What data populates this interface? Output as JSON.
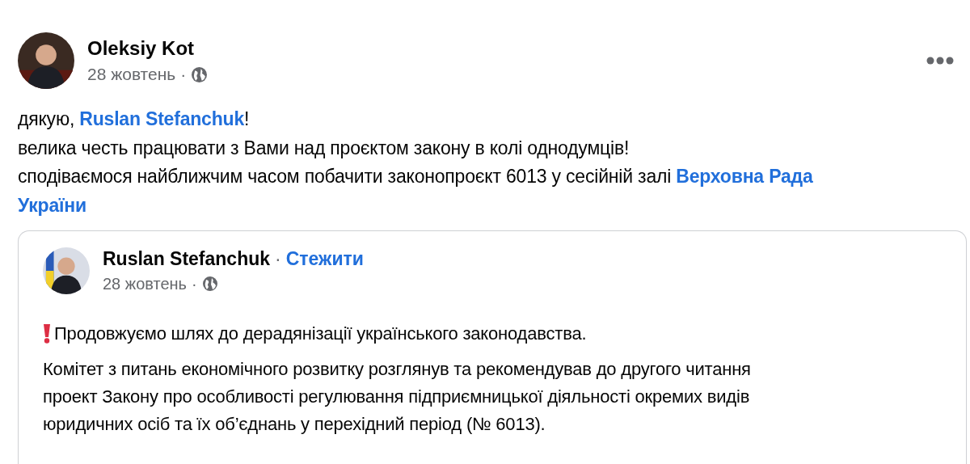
{
  "post": {
    "author": "Oleksiy Kot",
    "date": "28 жовтень",
    "separator": "·",
    "lines": [
      [
        {
          "kind": "text",
          "text": "дякую, "
        },
        {
          "kind": "link",
          "text": "Ruslan Stefanchuk"
        },
        {
          "kind": "text",
          "text": "!"
        }
      ],
      [
        {
          "kind": "text",
          "text": "велика честь працювати з Вами над проєктом закону в колі однодумців!"
        }
      ],
      [
        {
          "kind": "text",
          "text": "сподіваємося найближчим часом побачити законопроєкт 6013 у сесійній залі "
        },
        {
          "kind": "link",
          "text": "Верховна Рада"
        }
      ],
      [
        {
          "kind": "link",
          "text": "України"
        }
      ]
    ],
    "shared": {
      "author": "Ruslan Stefanchuk",
      "separator": "·",
      "follow": "Стежити",
      "date": "28 жовтень",
      "date_separator": "·",
      "paragraphs": [
        {
          "kind": "alert",
          "lines": [
            "Продовжуємо шлях до дерадянізації українського законодавства."
          ]
        },
        {
          "kind": "plain",
          "lines": [
            "Комітет з питань економічного розвитку розглянув та рекомендував до другого читання",
            "проект Закону про особливості регулювання підприємницької діяльності окремих видів",
            "юридичних осіб та їх об’єднань у перехідний період (№ 6013)."
          ]
        }
      ]
    }
  }
}
